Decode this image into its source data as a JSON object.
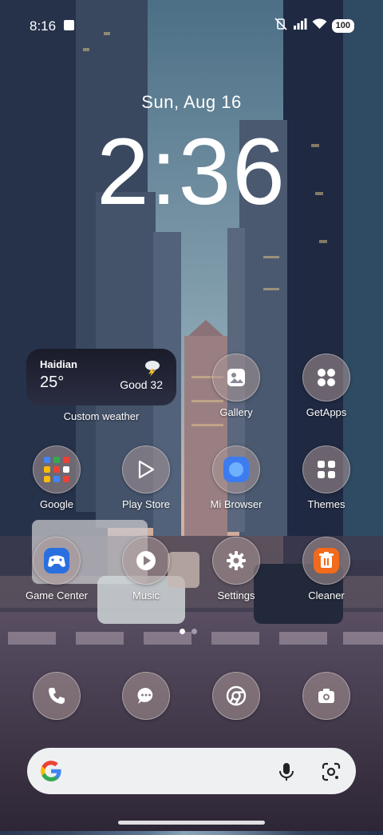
{
  "status_bar": {
    "time": "8:16",
    "battery": "100"
  },
  "lock": {
    "date": "Sun, Aug 16",
    "clock": "2:36"
  },
  "weather_widget": {
    "city": "Haidian",
    "temperature": "25°",
    "air_quality": "Good 32",
    "label": "Custom weather"
  },
  "apps": {
    "gallery": "Gallery",
    "getapps": "GetApps",
    "google": "Google",
    "play_store": "Play Store",
    "mi_browser": "Mi Browser",
    "themes": "Themes",
    "game_center": "Game Center",
    "music": "Music",
    "settings": "Settings",
    "cleaner": "Cleaner"
  },
  "colors": {
    "accent_blue": "#3d7cf0",
    "cleaner_orange": "#f26a1b",
    "game_blue": "#2a6fe0"
  }
}
